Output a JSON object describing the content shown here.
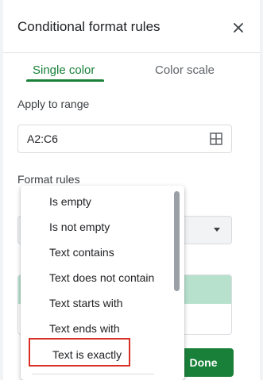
{
  "panel": {
    "title": "Conditional format rules",
    "close_icon": "close-icon"
  },
  "tabs": [
    {
      "label": "Single color",
      "active": true
    },
    {
      "label": "Color scale",
      "active": false
    }
  ],
  "apply_to_range": {
    "label": "Apply to range",
    "value": "A2:C6",
    "icon": "grid-select-icon"
  },
  "format_rules": {
    "label": "Format rules"
  },
  "dropdown": {
    "items": [
      {
        "label": "Is empty"
      },
      {
        "label": "Is not empty"
      },
      {
        "label": "Text contains"
      },
      {
        "label": "Text does not contain"
      },
      {
        "label": "Text starts with"
      },
      {
        "label": "Text ends with"
      },
      {
        "label": "Text is exactly",
        "highlighted": true
      }
    ]
  },
  "buttons": {
    "done": "Done"
  },
  "colors": {
    "accent": "#188038",
    "highlight_border": "#d93025",
    "preview_fill": "#b7e1cd"
  }
}
